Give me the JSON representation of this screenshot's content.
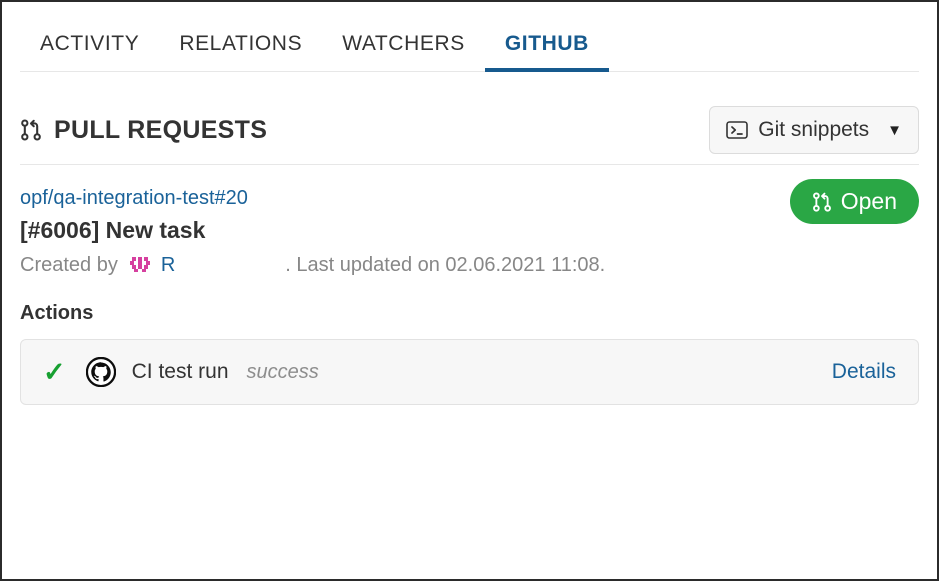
{
  "tabs": [
    {
      "label": "ACTIVITY",
      "active": false
    },
    {
      "label": "RELATIONS",
      "active": false
    },
    {
      "label": "WATCHERS",
      "active": false
    },
    {
      "label": "GITHUB",
      "active": true
    }
  ],
  "section": {
    "title": "PULL REQUESTS",
    "icon": "git-pull-request-icon",
    "git_snippets": {
      "label": "Git snippets",
      "icon": "terminal-icon",
      "caret": "▼"
    }
  },
  "pull_request": {
    "repo_link": "opf/qa-integration-test#20",
    "title": "[#6006] New task",
    "created_by_prefix": "Created by",
    "author": "R",
    "author_avatar": "identicon-avatar",
    "updated_text": ". Last updated on 02.06.2021 11:08.",
    "status": {
      "label": "Open",
      "icon": "git-pull-request-icon",
      "color": "#2aa745"
    }
  },
  "actions": {
    "heading": "Actions",
    "items": [
      {
        "check": "✓",
        "provider_icon": "github-octocat-icon",
        "name": "CI test run",
        "status": "success",
        "details_label": "Details"
      }
    ]
  },
  "colors": {
    "accent_blue": "#175a8e",
    "link_blue": "#1a6299",
    "success_green": "#2aa745",
    "check_green": "#17a031",
    "text_dark": "#333333",
    "muted_gray": "#878787"
  }
}
